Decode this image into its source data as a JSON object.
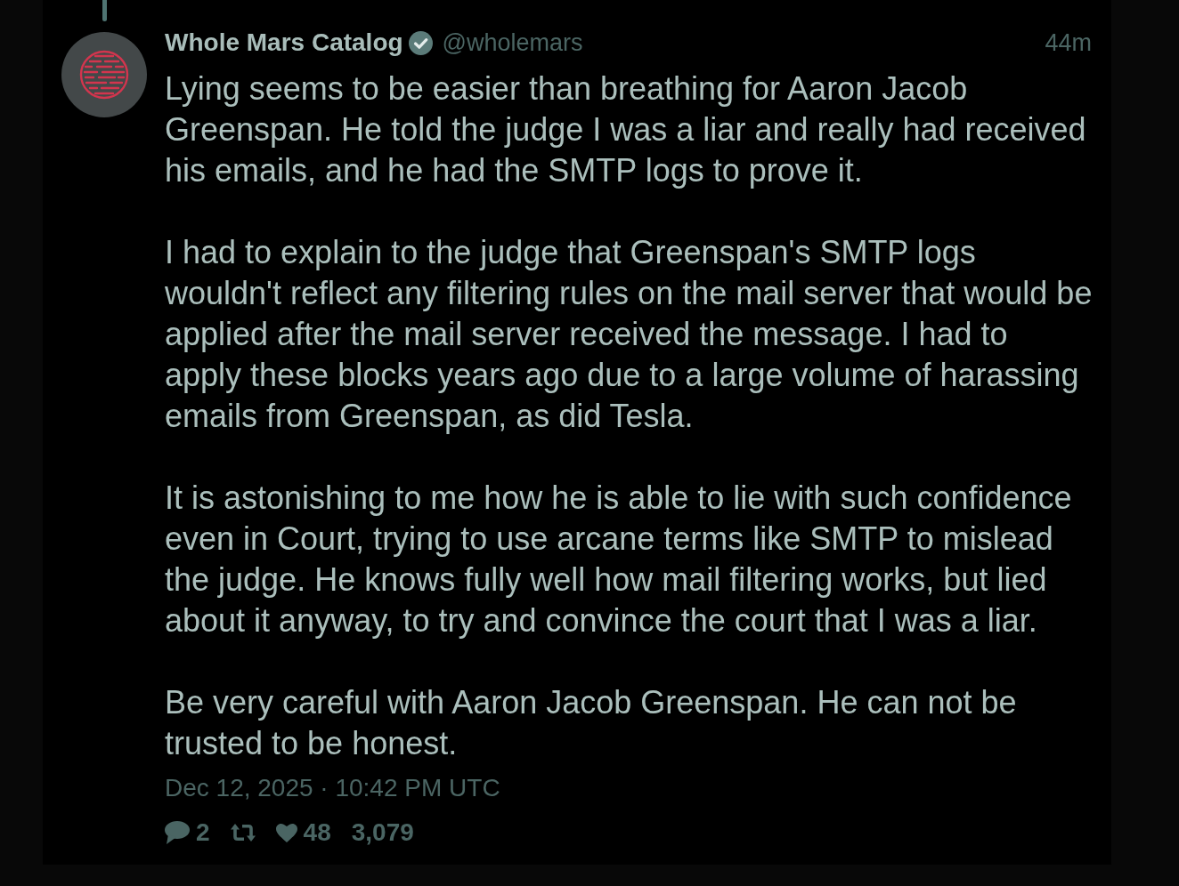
{
  "tweet": {
    "author": {
      "name": "Whole Mars Catalog",
      "verified": true,
      "handle": "@wholemars"
    },
    "time": "44m",
    "paragraphs": [
      {
        "lines": [
          "Lying seems to be easier than breathing for Aaron Jacob",
          "Greenspan. He told the judge I was a liar and really had received",
          "his emails, and he had the SMTP logs to prove it."
        ]
      },
      {
        "lines": [
          "I had to explain to the judge that Greenspan's SMTP logs",
          "wouldn't reflect any filtering rules on the mail server that would be",
          "applied after the mail server received the message. I had to",
          "apply these blocks years ago due to a large volume of harassing",
          "emails from Greenspan, as did Tesla."
        ]
      },
      {
        "lines": [
          "It is astonishing to me how he is able to lie with such confidence",
          "even in Court, trying to use arcane terms like SMTP to mislead",
          "the judge. He knows fully well how mail filtering works, but lied",
          "about it anyway, to try and convince the court that I was a liar."
        ]
      },
      {
        "lines": [
          "Be very careful with Aaron Jacob Greenspan. He can not be",
          "trusted to be honest."
        ]
      }
    ],
    "date": "Dec 12, 2025 · 10:42 PM UTC",
    "stats": [
      {
        "kind": "reply",
        "count": "2"
      },
      {
        "kind": "retweet"
      },
      {
        "kind": "like",
        "count": "48"
      },
      {
        "kind": "views",
        "count": "3,079"
      }
    ]
  }
}
